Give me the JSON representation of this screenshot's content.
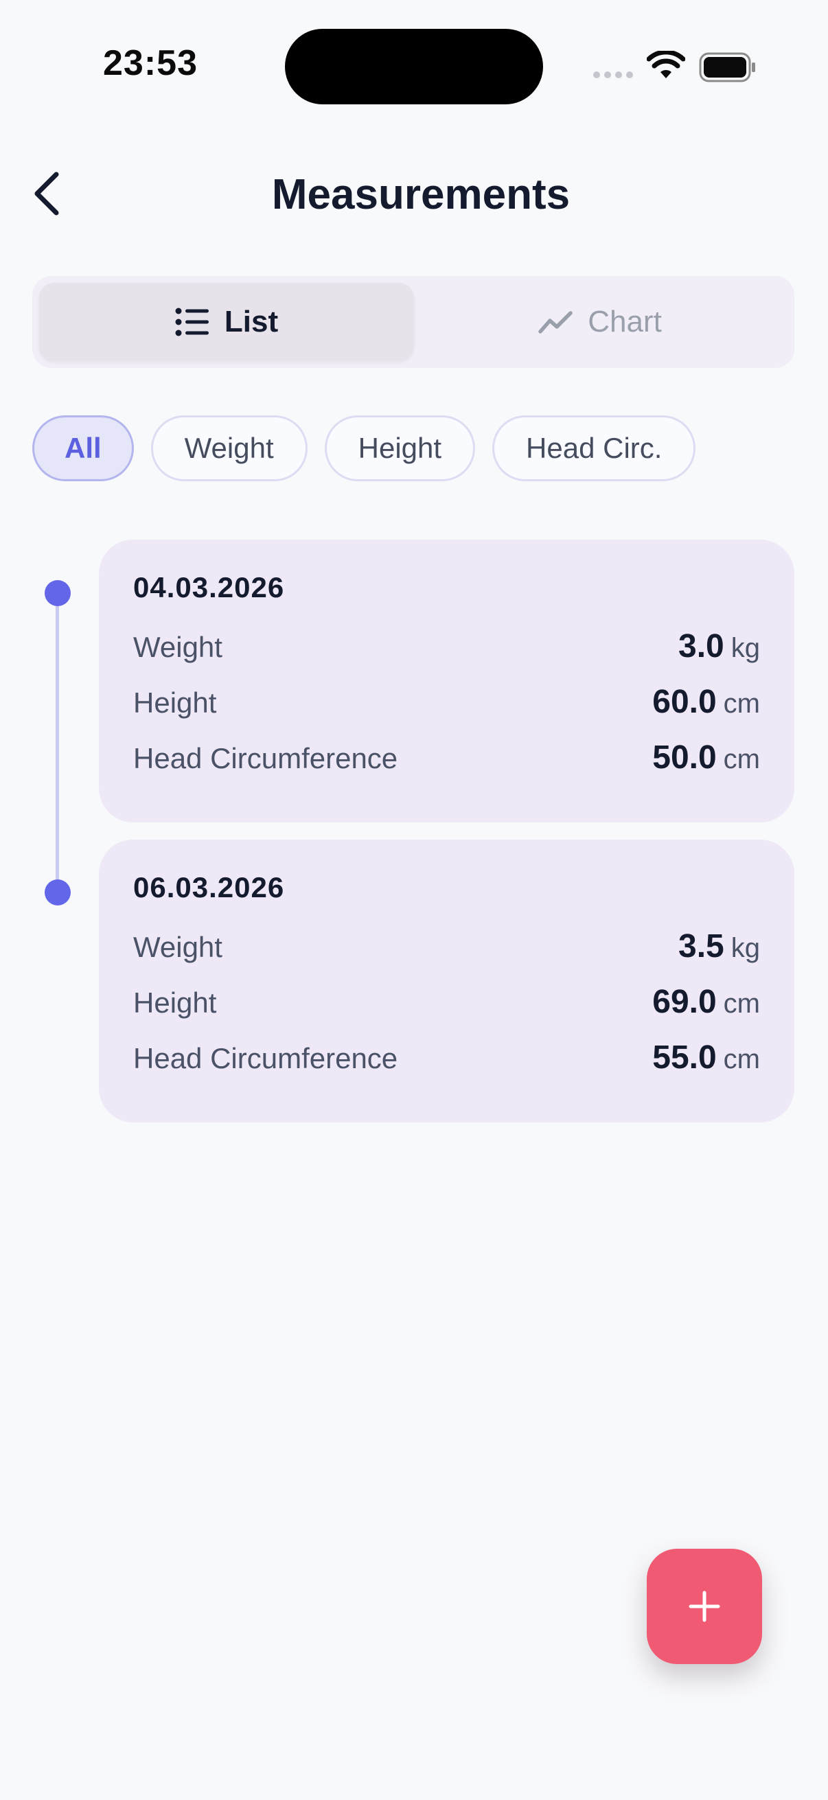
{
  "status": {
    "time": "23:53"
  },
  "header": {
    "title": "Measurements"
  },
  "view_toggle": {
    "list_label": "List",
    "chart_label": "Chart",
    "selected": "List"
  },
  "filters": [
    {
      "label": "All",
      "active": true
    },
    {
      "label": "Weight",
      "active": false
    },
    {
      "label": "Height",
      "active": false
    },
    {
      "label": "Head Circ.",
      "active": false
    }
  ],
  "entries": [
    {
      "date": "04.03.2026",
      "rows": [
        {
          "label": "Weight",
          "value": "3.0",
          "unit": "kg"
        },
        {
          "label": "Height",
          "value": "60.0",
          "unit": "cm"
        },
        {
          "label": "Head Circumference",
          "value": "50.0",
          "unit": "cm"
        }
      ]
    },
    {
      "date": "06.03.2026",
      "rows": [
        {
          "label": "Weight",
          "value": "3.5",
          "unit": "kg"
        },
        {
          "label": "Height",
          "value": "69.0",
          "unit": "cm"
        },
        {
          "label": "Head Circumference",
          "value": "55.0",
          "unit": "cm"
        }
      ]
    }
  ],
  "icons": {
    "back": "chevron-left-icon",
    "list": "list-icon",
    "chart": "chart-line-icon",
    "add": "plus-icon"
  },
  "colors": {
    "accent": "#6466ea",
    "fab": "#f05a73",
    "card": "#efe8f6"
  }
}
